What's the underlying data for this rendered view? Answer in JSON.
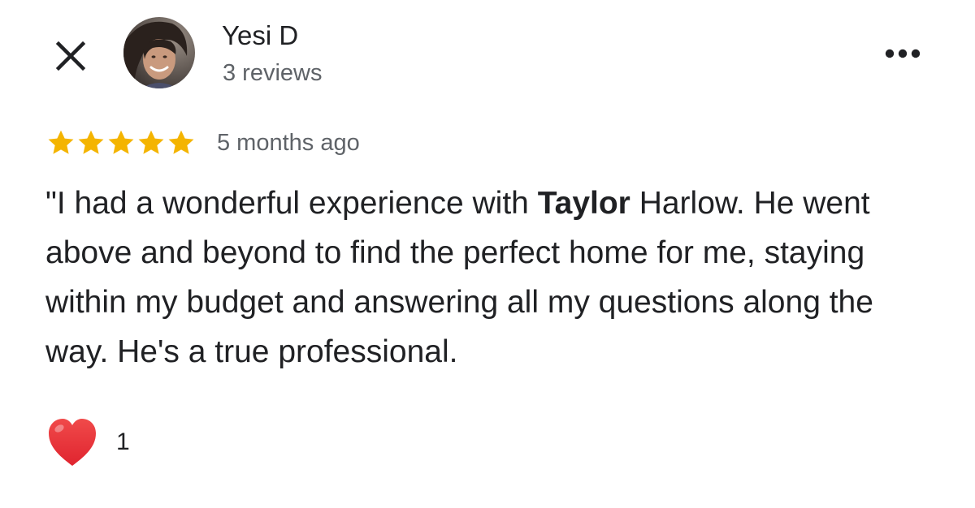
{
  "header": {
    "close_icon": "close-icon",
    "more_icon": "more-options-icon"
  },
  "reviewer": {
    "name": "Yesi D",
    "review_count": "3 reviews"
  },
  "review": {
    "rating": 5,
    "rating_max": 5,
    "star_color": "#f4b400",
    "date": "5 months ago",
    "text_before": "\"I had a wonderful experience with ",
    "text_bold": "Taylor",
    "text_after": " Harlow. He went above and beyond to find the perfect home for me, staying within my budget and answering all my questions along the way. He's a true professional."
  },
  "reactions": {
    "icon": "heart-icon",
    "color": "#e0242f",
    "count": "1"
  }
}
